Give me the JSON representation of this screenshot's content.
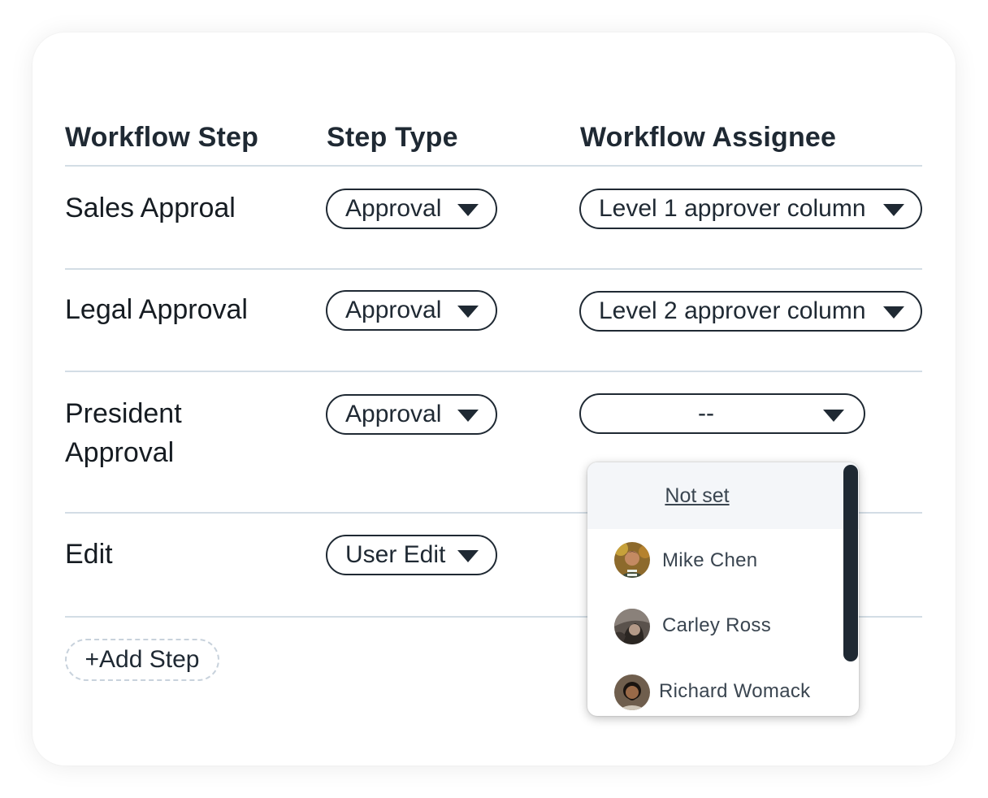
{
  "table": {
    "headers": [
      "Workflow Step",
      "Step Type",
      "Workflow Assignee"
    ],
    "rows": [
      {
        "step": "Sales Approal",
        "type": "Approval",
        "assignee": "Level 1 approver column"
      },
      {
        "step": "Legal Approval",
        "type": "Approval",
        "assignee": "Level 2 approver column"
      },
      {
        "step_line1": "President",
        "step_line2": "Approval",
        "type": "Approval",
        "assignee": "--"
      },
      {
        "step": "Edit",
        "type": "User Edit"
      }
    ],
    "add_step_label": "+Add Step"
  },
  "assignee_dropdown": {
    "not_set_label": "Not set",
    "options": [
      "Mike Chen",
      "Carley Ross",
      "Richard Womack"
    ]
  },
  "colors": {
    "text": "#1f2933",
    "divider": "#d3dde5",
    "dropdown_hover": "#f4f6f9"
  }
}
